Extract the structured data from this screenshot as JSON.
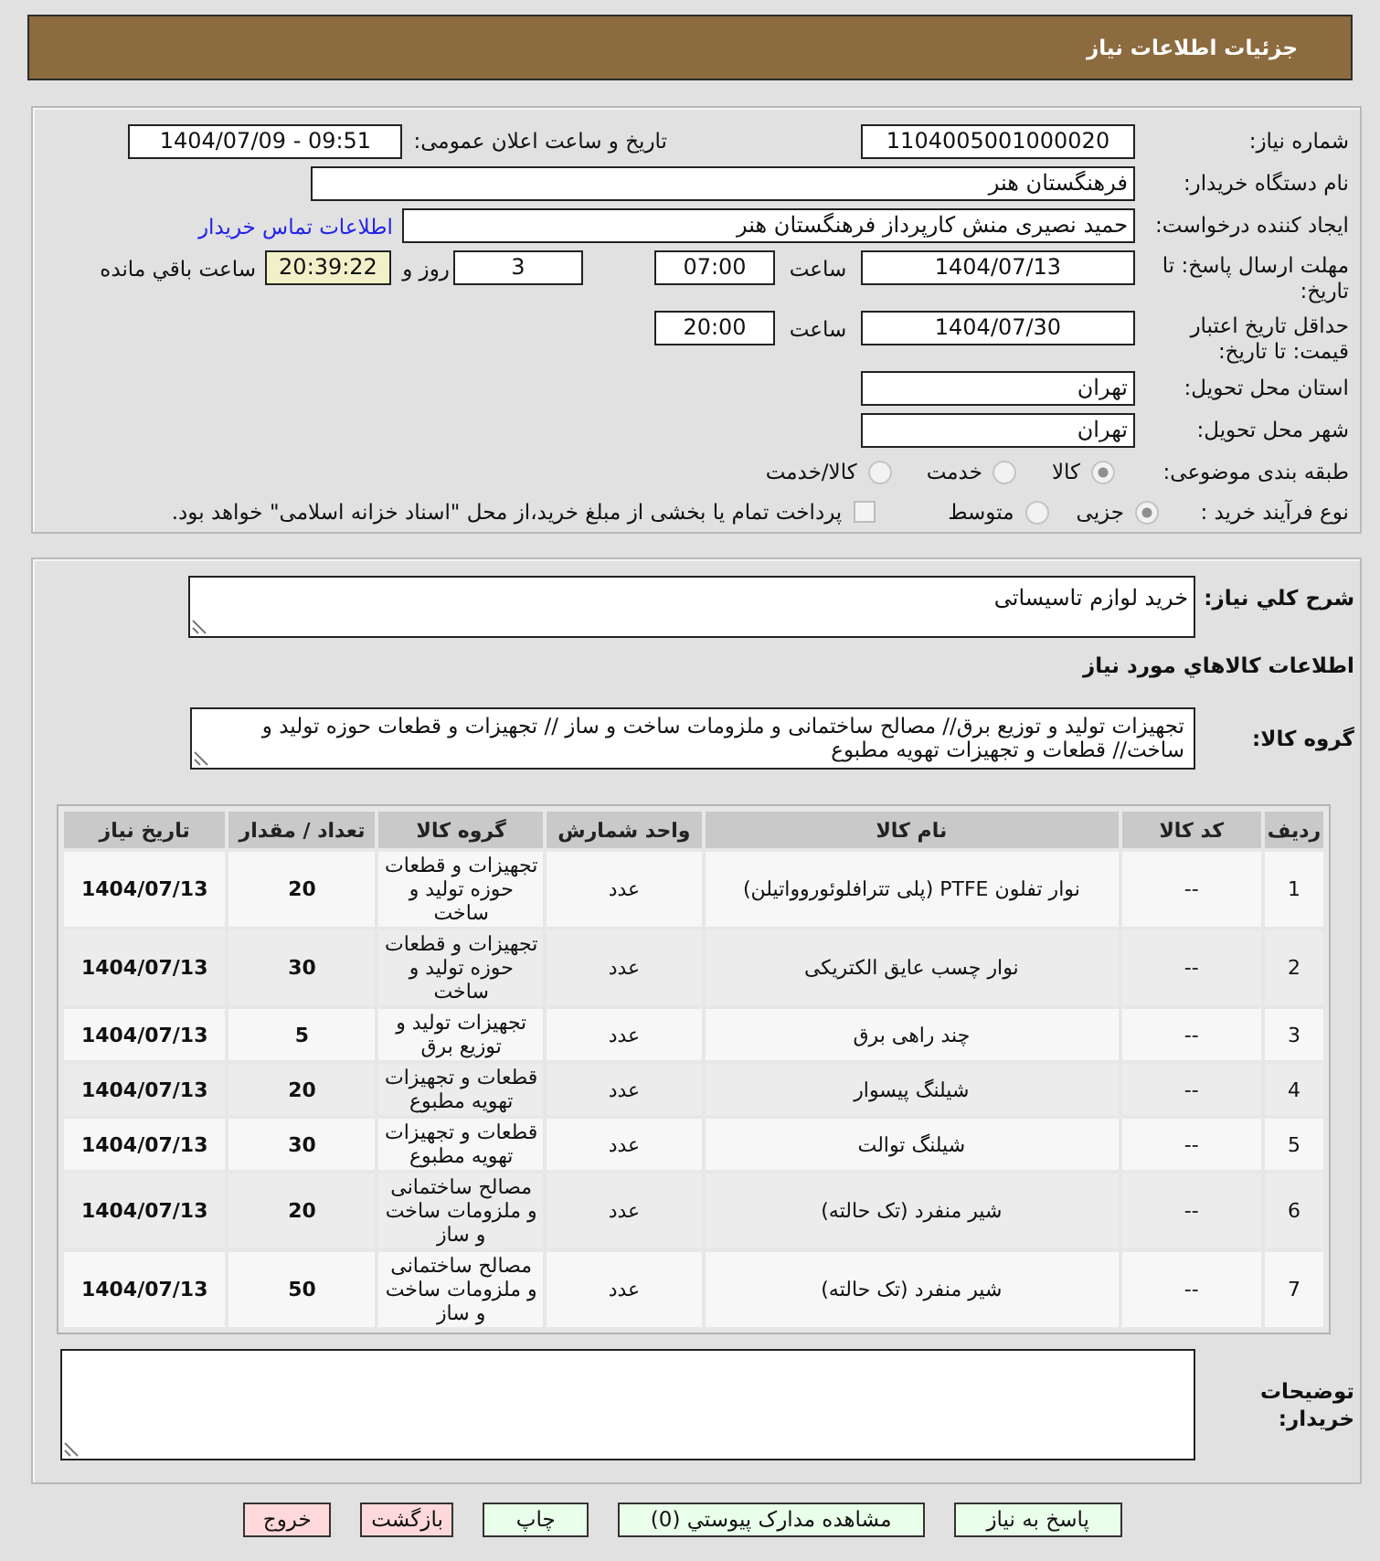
{
  "window": {
    "title": "جزئیات اطلاعات نیاز"
  },
  "need_details": {
    "need_number": {
      "label": "شماره نیاز:",
      "value": "1104005001000020"
    },
    "announcement": {
      "label": "تاریخ و ساعت اعلان عمومی:",
      "value": "1404/07/09 - 09:51"
    },
    "buyer_organization": {
      "label": "نام دستگاه خریدار:",
      "value": "فرهنگستان هنر"
    },
    "requester": {
      "label": "ایجاد کننده درخواست:",
      "value": "حمید نصیری منش کارپرداز فرهنگستان هنر",
      "link": "اطلاعات تماس خریدار"
    },
    "reply_deadline": {
      "label": "مهلت ارسال پاسخ: تا تاریخ:",
      "date": "1404/07/13",
      "time_label": "ساعت",
      "time": "07:00",
      "days": "3",
      "days_label": "روز و",
      "remaining": "20:39:22",
      "remaining_label": "ساعت باقي مانده"
    },
    "price_validity": {
      "label": "حداقل تاریخ اعتبار قیمت: تا تاریخ:",
      "date": "1404/07/30",
      "time_label": "ساعت",
      "time": "20:00"
    },
    "delivery_province": {
      "label": "استان محل تحویل:",
      "value": "تهران"
    },
    "delivery_city": {
      "label": "شهر محل تحویل:",
      "value": "تهران"
    },
    "category": {
      "label": "طبقه بندی موضوعی:",
      "options": [
        {
          "label": "کالا",
          "selected": true
        },
        {
          "label": "خدمت",
          "selected": false
        },
        {
          "label": "کالا/خدمت",
          "selected": false
        }
      ]
    },
    "purchase_process": {
      "label": "نوع فرآیند خرید :",
      "options": [
        {
          "label": "جزیی",
          "selected": true
        },
        {
          "label": "متوسط",
          "selected": false
        }
      ],
      "treasury_payment": {
        "label": "پرداخت تمام یا بخشی از مبلغ خرید،از محل \"اسناد خزانه اسلامی\" خواهد بود.",
        "checked": false
      }
    }
  },
  "goods_details": {
    "summary": {
      "label": "شرح کلي نیاز:",
      "value": "خرید لوازم تاسیساتی"
    },
    "heading": "اطلاعات کالاهاي مورد نیاز",
    "goods_group": {
      "label": "گروه کالا:",
      "value": "تجهیزات تولید و توزیع برق// مصالح ساختمانی و ملزومات ساخت و ساز // تجهیزات و قطعات حوزه تولید و ساخت//  قطعات و تجهیزات تهویه مطبوع"
    },
    "table": {
      "columns": [
        "ردیف",
        "کد کالا",
        "نام کالا",
        "واحد شمارش",
        "گروه کالا",
        "تعداد / مقدار",
        "تاریخ نیاز"
      ],
      "rows": [
        {
          "number": "1",
          "code": "--",
          "name": "نوار تفلون PTFE (پلی تترافلوئوروواتیلن)",
          "unit": "عدد",
          "group": "تجهیزات و قطعات حوزه تولید و ساخت",
          "quantity": "20",
          "need_date": "1404/07/13"
        },
        {
          "number": "2",
          "code": "--",
          "name": "نوار چسب عایق الکتریکی",
          "unit": "عدد",
          "group": "تجهیزات و قطعات حوزه تولید و ساخت",
          "quantity": "30",
          "need_date": "1404/07/13"
        },
        {
          "number": "3",
          "code": "--",
          "name": "چند راهی برق",
          "unit": "عدد",
          "group": "تجهیزات تولید و توزیع برق",
          "quantity": "5",
          "need_date": "1404/07/13"
        },
        {
          "number": "4",
          "code": "--",
          "name": "شیلنگ پیسوار",
          "unit": "عدد",
          "group": "قطعات و تجهیزات تهویه مطبوع",
          "quantity": "20",
          "need_date": "1404/07/13"
        },
        {
          "number": "5",
          "code": "--",
          "name": "شیلنگ توالت",
          "unit": "عدد",
          "group": "قطعات و تجهیزات تهویه مطبوع",
          "quantity": "30",
          "need_date": "1404/07/13"
        },
        {
          "number": "6",
          "code": "--",
          "name": "شیر منفرد (تک حالته)",
          "unit": "عدد",
          "group": "مصالح ساختمانی و ملزومات ساخت و ساز",
          "quantity": "20",
          "need_date": "1404/07/13"
        },
        {
          "number": "7",
          "code": "--",
          "name": "شیر منفرد (تک حالته)",
          "unit": "عدد",
          "group": "مصالح ساختمانی و ملزومات ساخت و ساز",
          "quantity": "50",
          "need_date": "1404/07/13"
        }
      ]
    },
    "buyer_notes": {
      "label": "توضیحات خریدار:"
    }
  },
  "buttons": [
    {
      "label": "پاسخ به نیاز",
      "kind": "primary"
    },
    {
      "label": "مشاهده مدارک پیوستي (0)",
      "kind": "primary"
    },
    {
      "label": "چاپ",
      "kind": "primary"
    },
    {
      "label": "بازگشت",
      "kind": "danger"
    },
    {
      "label": "خروج",
      "kind": "danger"
    }
  ]
}
